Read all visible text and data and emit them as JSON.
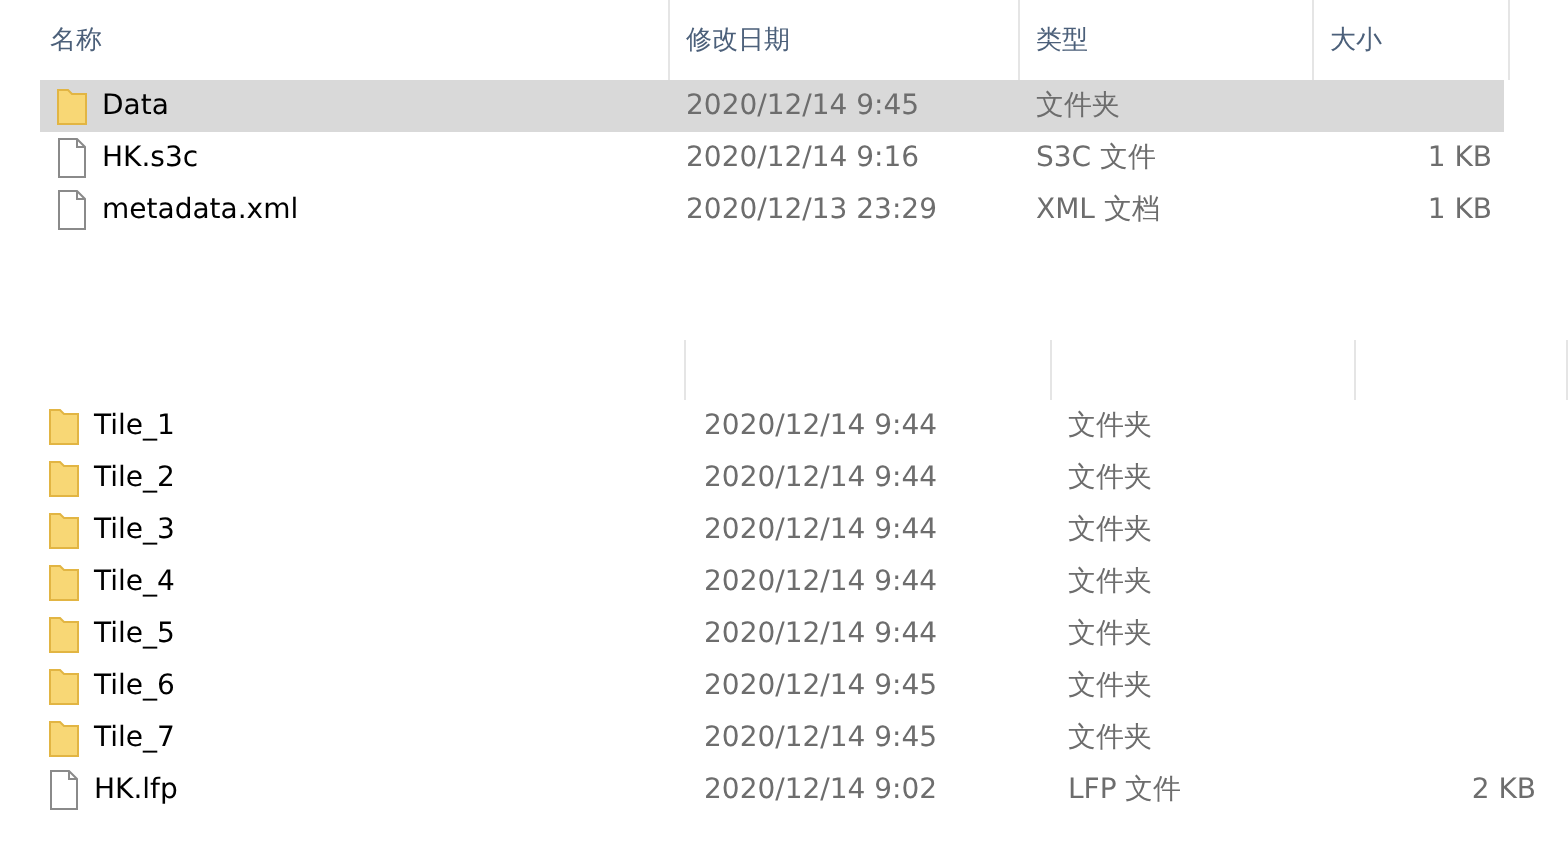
{
  "top_list": {
    "columns": [
      "名称",
      "修改日期",
      "类型",
      "大小"
    ],
    "rows": [
      {
        "kind": "folder",
        "name": "Data",
        "modified": "2020/12/14 9:45",
        "type": "文件夹",
        "selected": true
      },
      {
        "kind": "file",
        "name": "HK.s3c",
        "modified": "2020/12/14 9:16",
        "type": "S3C 文件",
        "size": "1 KB",
        "selected": false
      },
      {
        "kind": "file",
        "name": "metadata.xml",
        "modified": "2020/12/13 23:29",
        "type": "XML 文档",
        "size": "1 KB",
        "selected": false
      }
    ]
  },
  "bottom_list": {
    "rows": [
      {
        "kind": "folder",
        "name": "Tile_1",
        "modified": "2020/12/14 9:44",
        "type": "文件夹"
      },
      {
        "kind": "folder",
        "name": "Tile_2",
        "modified": "2020/12/14 9:44",
        "type": "文件夹"
      },
      {
        "kind": "folder",
        "name": "Tile_3",
        "modified": "2020/12/14 9:44",
        "type": "文件夹"
      },
      {
        "kind": "folder",
        "name": "Tile_4",
        "modified": "2020/12/14 9:44",
        "type": "文件夹"
      },
      {
        "kind": "folder",
        "name": "Tile_5",
        "modified": "2020/12/14 9:44",
        "type": "文件夹"
      },
      {
        "kind": "folder",
        "name": "Tile_6",
        "modified": "2020/12/14 9:45",
        "type": "文件夹"
      },
      {
        "kind": "folder",
        "name": "Tile_7",
        "modified": "2020/12/14 9:45",
        "type": "文件夹"
      },
      {
        "kind": "file",
        "name": "HK.lfp",
        "modified": "2020/12/14 9:02",
        "type": "LFP 文件",
        "size": "2 KB"
      }
    ]
  }
}
